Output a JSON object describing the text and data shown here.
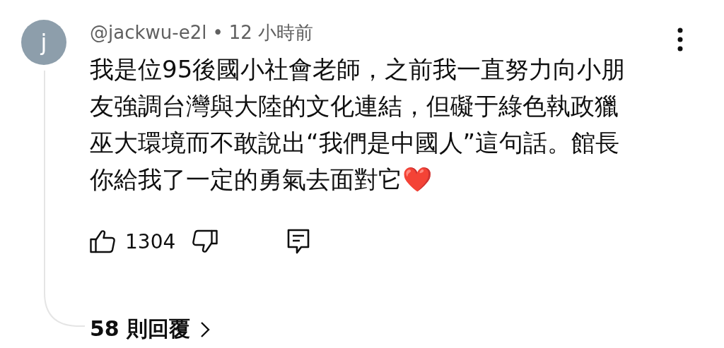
{
  "comment": {
    "avatar_letter": "j",
    "author": "@jackwu-e2l",
    "separator": "•",
    "time": "12 小時前",
    "text": "我是位95後國小社會老師，之前我一直努力向小朋友強調台灣與大陸的文化連結，但礙于綠色執政獵巫大環境而不敢說出“我們是中國人”這句話。館長你給我了一定的勇氣去面對它❤️",
    "likes": "1304",
    "replies": "58 則回覆"
  }
}
